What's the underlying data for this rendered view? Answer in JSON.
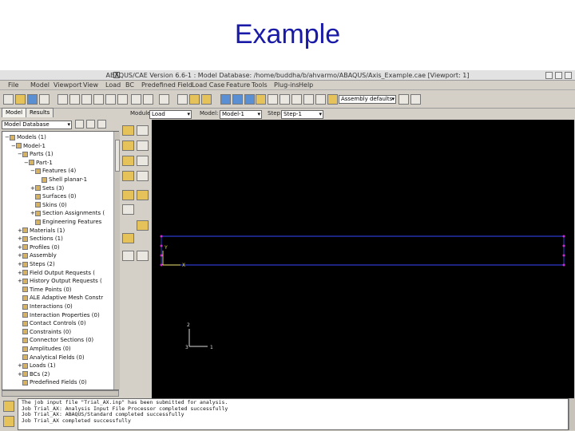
{
  "slide": {
    "title": "Example"
  },
  "window": {
    "title": "ABAQUS/CAE Version 6.6-1 : Model Database: /home/buddha/b/ahvarmo/ABAQUS/Axis_Example.cae [Viewport: 1]"
  },
  "menu": [
    "File",
    "Model",
    "Viewport",
    "View",
    "Load",
    "BC",
    "Predefined Field",
    "Load Case",
    "Feature",
    "Tools",
    "Plug-ins",
    "Help"
  ],
  "toolbar": {
    "assembly_combo": "Assembly defaults",
    "module_label": "Module:",
    "module_value": "Load",
    "model_label": "Model:",
    "model_value": "Model-1",
    "step_label": "Step:",
    "step_value": "Step-1"
  },
  "tabs": [
    "Model",
    "Results"
  ],
  "tree": {
    "combo": "Model Database",
    "items": [
      {
        "label": "Models (1)",
        "level": 0,
        "ex": "−"
      },
      {
        "label": "Model-1",
        "level": 1,
        "ex": "−"
      },
      {
        "label": "Parts (1)",
        "level": 2,
        "ex": "−"
      },
      {
        "label": "Part-1",
        "level": 3,
        "ex": "−"
      },
      {
        "label": "Features (4)",
        "level": 4,
        "ex": "−"
      },
      {
        "label": "Shell planar-1",
        "level": 5,
        "ex": ""
      },
      {
        "label": "Sets (3)",
        "level": 4,
        "ex": "+"
      },
      {
        "label": "Surfaces (0)",
        "level": 4,
        "ex": ""
      },
      {
        "label": "Skins (0)",
        "level": 4,
        "ex": ""
      },
      {
        "label": "Section Assignments (",
        "level": 4,
        "ex": "+"
      },
      {
        "label": "Engineering Features",
        "level": 4,
        "ex": ""
      },
      {
        "label": "Materials (1)",
        "level": 2,
        "ex": "+"
      },
      {
        "label": "Sections (1)",
        "level": 2,
        "ex": "+"
      },
      {
        "label": "Profiles (0)",
        "level": 2,
        "ex": "+"
      },
      {
        "label": "Assembly",
        "level": 2,
        "ex": "+"
      },
      {
        "label": "Steps (2)",
        "level": 2,
        "ex": "+"
      },
      {
        "label": "Field Output Requests (",
        "level": 2,
        "ex": "+"
      },
      {
        "label": "History Output Requests (",
        "level": 2,
        "ex": "+"
      },
      {
        "label": "Time Points (0)",
        "level": 2,
        "ex": ""
      },
      {
        "label": "ALE Adaptive Mesh Constr",
        "level": 2,
        "ex": ""
      },
      {
        "label": "Interactions (0)",
        "level": 2,
        "ex": ""
      },
      {
        "label": "Interaction Properties (0)",
        "level": 2,
        "ex": ""
      },
      {
        "label": "Contact Controls (0)",
        "level": 2,
        "ex": ""
      },
      {
        "label": "Constraints (0)",
        "level": 2,
        "ex": ""
      },
      {
        "label": "Connector Sections (0)",
        "level": 2,
        "ex": ""
      },
      {
        "label": "Amplitudes (0)",
        "level": 2,
        "ex": ""
      },
      {
        "label": "Analytical Fields (0)",
        "level": 2,
        "ex": ""
      },
      {
        "label": "Loads (1)",
        "level": 2,
        "ex": "+"
      },
      {
        "label": "BCs (2)",
        "level": 2,
        "ex": "+"
      },
      {
        "label": "Predefined Fields (0)",
        "level": 2,
        "ex": ""
      }
    ]
  },
  "viewport": {
    "triad_labels": [
      "2",
      "3",
      "1"
    ],
    "part_axis_labels": [
      "Y",
      "X"
    ],
    "colors": {
      "background": "#000000",
      "edge": "#2d3bd0",
      "node": "#d12ad1",
      "triad": "#dcdcdc",
      "part_axis": "#e8d840"
    }
  },
  "messages": [
    "The job input file \"Trial_AX.inp\" has been submitted for analysis.",
    "Job Trial_AX: Analysis Input File Processor completed successfully",
    "Job Trial_AX: ABAQUS/Standard completed successfully",
    "Job Trial_AX completed successfully"
  ]
}
